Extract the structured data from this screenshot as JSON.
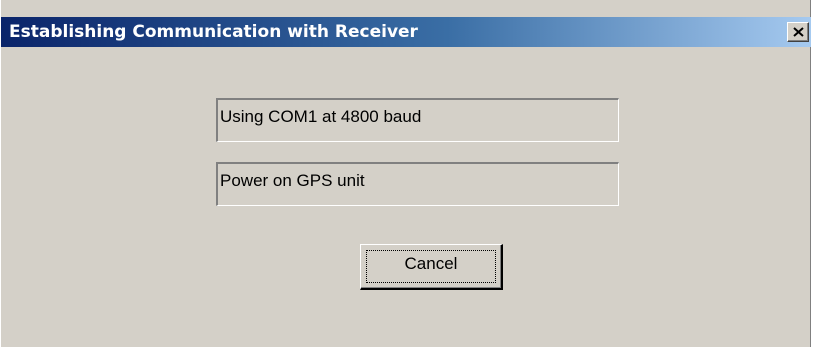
{
  "window": {
    "title": "Establishing Communication with Receiver",
    "close_icon": "close-icon",
    "colors": {
      "title_bar_start": "#0a246a",
      "title_bar_end": "#a6caf0",
      "face": "#d4d0c8"
    }
  },
  "status": {
    "port_text": "Using COM1 at 4800 baud",
    "instruction_text": "Power on GPS unit"
  },
  "buttons": {
    "cancel_label": "Cancel"
  }
}
